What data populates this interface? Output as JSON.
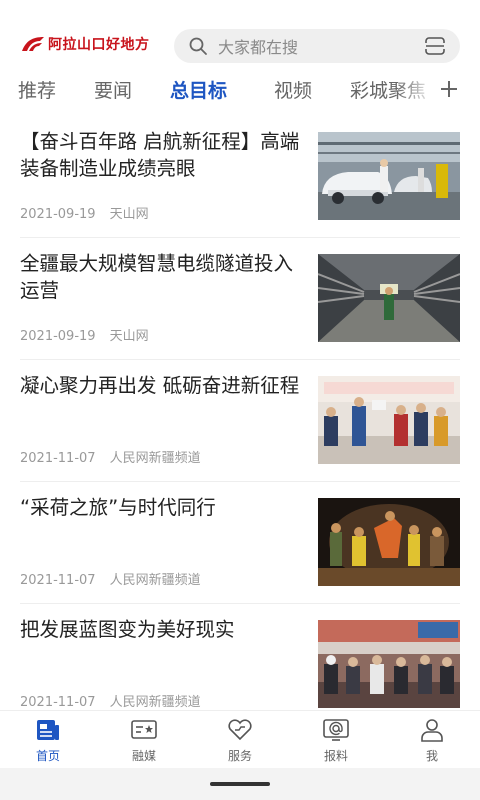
{
  "header": {
    "logo_text": "阿拉山口好地方",
    "search_placeholder": "大家都在搜"
  },
  "tabs": [
    {
      "label": "推荐",
      "active": false
    },
    {
      "label": "要闻",
      "active": false
    },
    {
      "label": "总目标",
      "active": true
    },
    {
      "label": "视频",
      "active": false
    },
    {
      "label": "彩城聚焦",
      "active": false
    }
  ],
  "articles": [
    {
      "title": "【奋斗百年路 启航新征程】高端装备制造业成绩亮眼",
      "date": "2021-09-19",
      "source": "天山网",
      "image": "factory-assembly-line-photo"
    },
    {
      "title": "全疆最大规模智慧电缆隧道投入运营",
      "date": "2021-09-19",
      "source": "天山网",
      "image": "cable-tunnel-photo"
    },
    {
      "title": "凝心聚力再出发 砥砺奋进新征程",
      "date": "2021-11-07",
      "source": "人民网新疆频道",
      "image": "group-meeting-photo"
    },
    {
      "title": "“采荷之旅”与时代同行",
      "date": "2021-11-07",
      "source": "人民网新疆频道",
      "image": "stage-dance-photo"
    },
    {
      "title": "把发展蓝图变为美好现实",
      "date": "2021-11-07",
      "source": "人民网新疆频道",
      "image": "audience-gathering-photo"
    }
  ],
  "bottom_nav": [
    {
      "label": "首页",
      "icon": "home-news-icon",
      "active": true
    },
    {
      "label": "融媒",
      "icon": "media-card-icon",
      "active": false
    },
    {
      "label": "服务",
      "icon": "heart-service-icon",
      "active": false
    },
    {
      "label": "报料",
      "icon": "report-at-icon",
      "active": false
    },
    {
      "label": "我",
      "icon": "person-icon",
      "active": false
    }
  ],
  "colors": {
    "accent": "#1e56c2",
    "logo": "#c8141c"
  }
}
